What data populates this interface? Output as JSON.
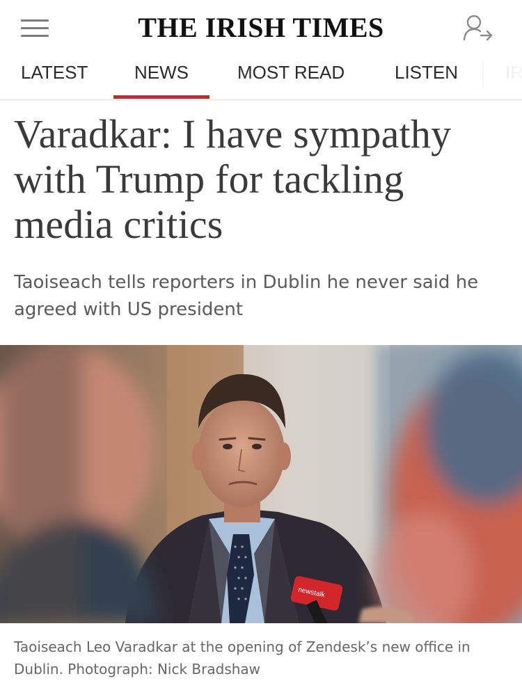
{
  "header": {
    "masthead": "THE IRISH TIMES",
    "menu_icon": "hamburger-menu-icon",
    "account_icon": "user-account-icon"
  },
  "nav": {
    "items": [
      {
        "label": "LATEST",
        "active": false
      },
      {
        "label": "NEWS",
        "active": true
      },
      {
        "label": "MOST READ",
        "active": false
      },
      {
        "label": "LISTEN",
        "active": false
      },
      {
        "label": "IR",
        "active": false
      }
    ],
    "active_color": "#c8262b"
  },
  "article": {
    "headline": "Varadkar: I have sympathy with Trump for tackling media critics",
    "standfirst": "Taoiseach tells reporters in Dublin he never said he agreed with US president",
    "photo_caption": "Taoiseach Leo Varadkar at the opening of Zendesk’s new office in Dublin. Photograph: Nick Bradshaw",
    "microphone_label": "newstalk"
  }
}
